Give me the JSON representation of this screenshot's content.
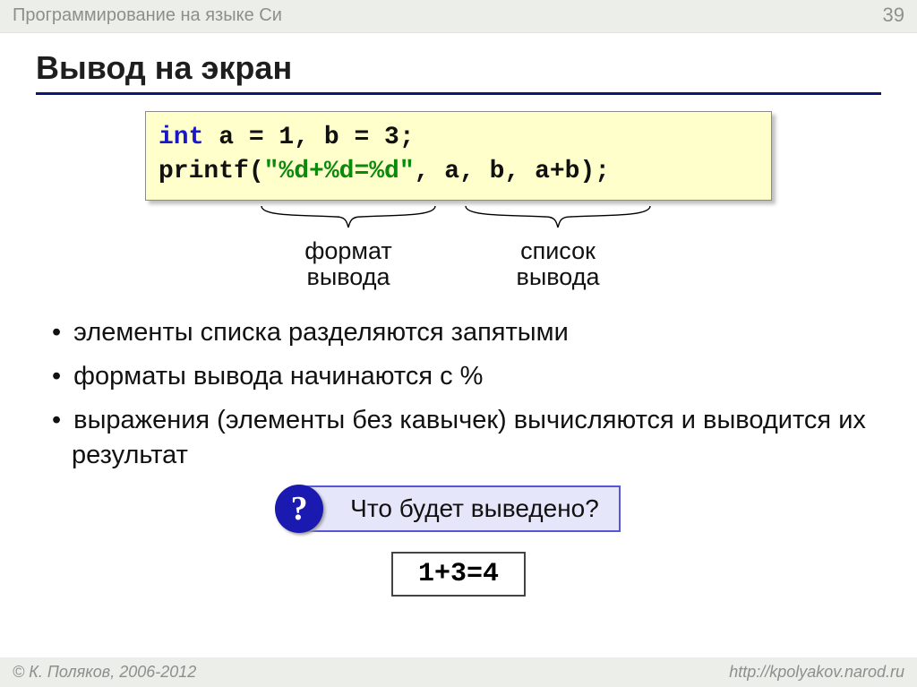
{
  "header": {
    "course": "Программирование на языке Си",
    "page": "39"
  },
  "title": "Вывод на экран",
  "code": {
    "line1": {
      "kw": "int",
      "rest": " a = 1, b = 3;"
    },
    "line2": {
      "fn": "printf(",
      "str": "\"%d+%d=%d\"",
      "rest": ", a, b, a+b);"
    }
  },
  "annotations": {
    "format": {
      "l1": "формат",
      "l2": "вывода"
    },
    "list": {
      "l1": "список",
      "l2": "вывода"
    }
  },
  "bullets": [
    "элементы списка разделяются запятыми",
    "форматы вывода начинаются с %",
    "выражения (элементы без кавычек) вычисляются и выводится их результат"
  ],
  "question": {
    "icon": "?",
    "text": "Что будет выведено?"
  },
  "answer": "1+3=4",
  "footer": {
    "left": "© К. Поляков, 2006-2012",
    "right": "http://kpolyakov.narod.ru"
  }
}
